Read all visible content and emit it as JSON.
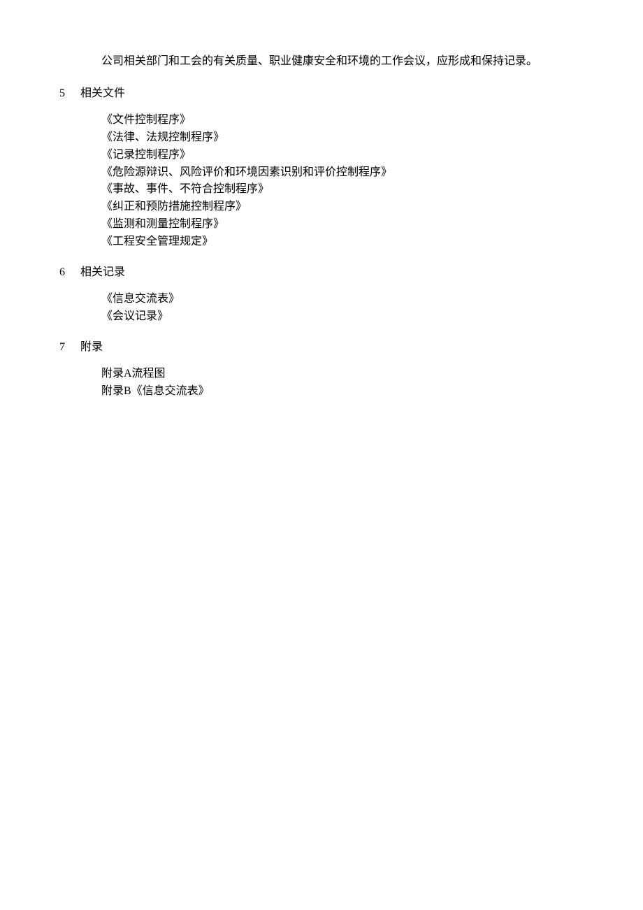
{
  "intro": "公司相关部门和工会的有关质量、职业健康安全和环境的工作会议，应形成和保持记录。",
  "sections": [
    {
      "number": "5",
      "title": "相关文件",
      "items": [
        "《文件控制程序》",
        "《法律、法规控制程序》",
        "《记录控制程序》",
        "《危险源辩识、风险评价和环境因素识别和评价控制程序》",
        "《事故、事件、不符合控制程序》",
        "《纠正和预防措施控制程序》",
        "《监测和测量控制程序》",
        "《工程安全管理规定》"
      ]
    },
    {
      "number": "6",
      "title": "相关记录",
      "items": [
        "《信息交流表》",
        "《会议记录》"
      ]
    },
    {
      "number": "7",
      "title": "附录",
      "items": [
        "附录A流程图",
        "附录B《信息交流表》"
      ]
    }
  ]
}
